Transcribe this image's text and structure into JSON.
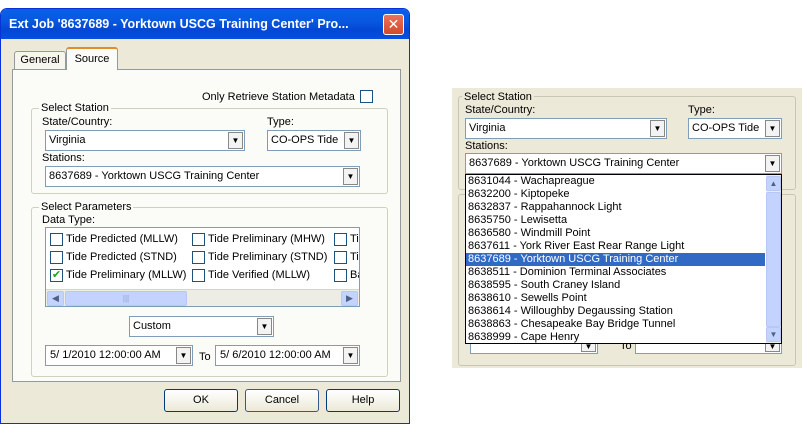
{
  "dialog": {
    "title": "Ext Job '8637689 - Yorktown USCG Training Center' Pro...",
    "close_glyph": "✕",
    "tabs": [
      {
        "label": "General"
      },
      {
        "label": "Source"
      }
    ],
    "only_metadata_label": "Only Retrieve Station Metadata",
    "select_station": {
      "legend": "Select Station",
      "state_label": "State/Country:",
      "state_value": "Virginia",
      "type_label": "Type:",
      "type_value": "CO-OPS Tide",
      "stations_label": "Stations:",
      "stations_value": "8637689 - Yorktown USCG Training Center"
    },
    "select_parameters": {
      "legend": "Select Parameters",
      "data_type_label": "Data Type:",
      "items": [
        {
          "label": "Tide Predicted (MLLW)",
          "checked": false
        },
        {
          "label": "Tide Preliminary (MHW)",
          "checked": false
        },
        {
          "label": "Tic",
          "checked": false
        },
        {
          "label": "Tide Predicted (STND)",
          "checked": false
        },
        {
          "label": "Tide Preliminary (STND)",
          "checked": false
        },
        {
          "label": "Tic",
          "checked": false
        },
        {
          "label": "Tide Preliminary (MLLW)",
          "checked": true
        },
        {
          "label": "Tide Verified (MLLW)",
          "checked": false
        },
        {
          "label": "Ba",
          "checked": false
        }
      ],
      "range_value": "Custom",
      "start_date": "5/  1/2010 12:00:00 AM",
      "to_label": "To",
      "end_date": "5/  6/2010 12:00:00 AM"
    },
    "buttons": {
      "ok": "OK",
      "cancel": "Cancel",
      "help": "Help"
    }
  },
  "zoom_panel": {
    "legend": "Select Station",
    "state_label": "State/Country:",
    "state_value": "Virginia",
    "type_label": "Type:",
    "type_value": "CO-OPS Tide",
    "stations_label": "Stations:",
    "stations_value": "8637689 - Yorktown USCG Training Center",
    "to_label": "To",
    "station_options": [
      {
        "label": "8631044 - Wachapreague",
        "selected": false
      },
      {
        "label": "8632200 - Kiptopeke",
        "selected": false
      },
      {
        "label": "8632837 - Rappahannock Light",
        "selected": false
      },
      {
        "label": "8635750 - Lewisetta",
        "selected": false
      },
      {
        "label": "8636580 - Windmill Point",
        "selected": false
      },
      {
        "label": "8637611 - York River East Rear Range Light",
        "selected": false
      },
      {
        "label": "8637689 - Yorktown USCG Training Center",
        "selected": true
      },
      {
        "label": "8638511 - Dominion Terminal Associates",
        "selected": false
      },
      {
        "label": "8638595 - South Craney Island",
        "selected": false
      },
      {
        "label": "8638610 - Sewells Point",
        "selected": false
      },
      {
        "label": "8638614 - Willoughby Degaussing Station",
        "selected": false
      },
      {
        "label": "8638863 - Chesapeake Bay Bridge Tunnel",
        "selected": false
      },
      {
        "label": "8638999 - Cape Henry",
        "selected": false
      }
    ]
  },
  "icons": {
    "dropdown_arrow": "▼",
    "scroll_left": "◀",
    "scroll_right": "▶",
    "scroll_up": "▲",
    "scroll_down": "▼",
    "grip": "|||",
    "check": "✔"
  },
  "colors": {
    "titlebar": "#0a5fe8",
    "selection": "#316ac5",
    "window_face": "#ece9d8"
  }
}
